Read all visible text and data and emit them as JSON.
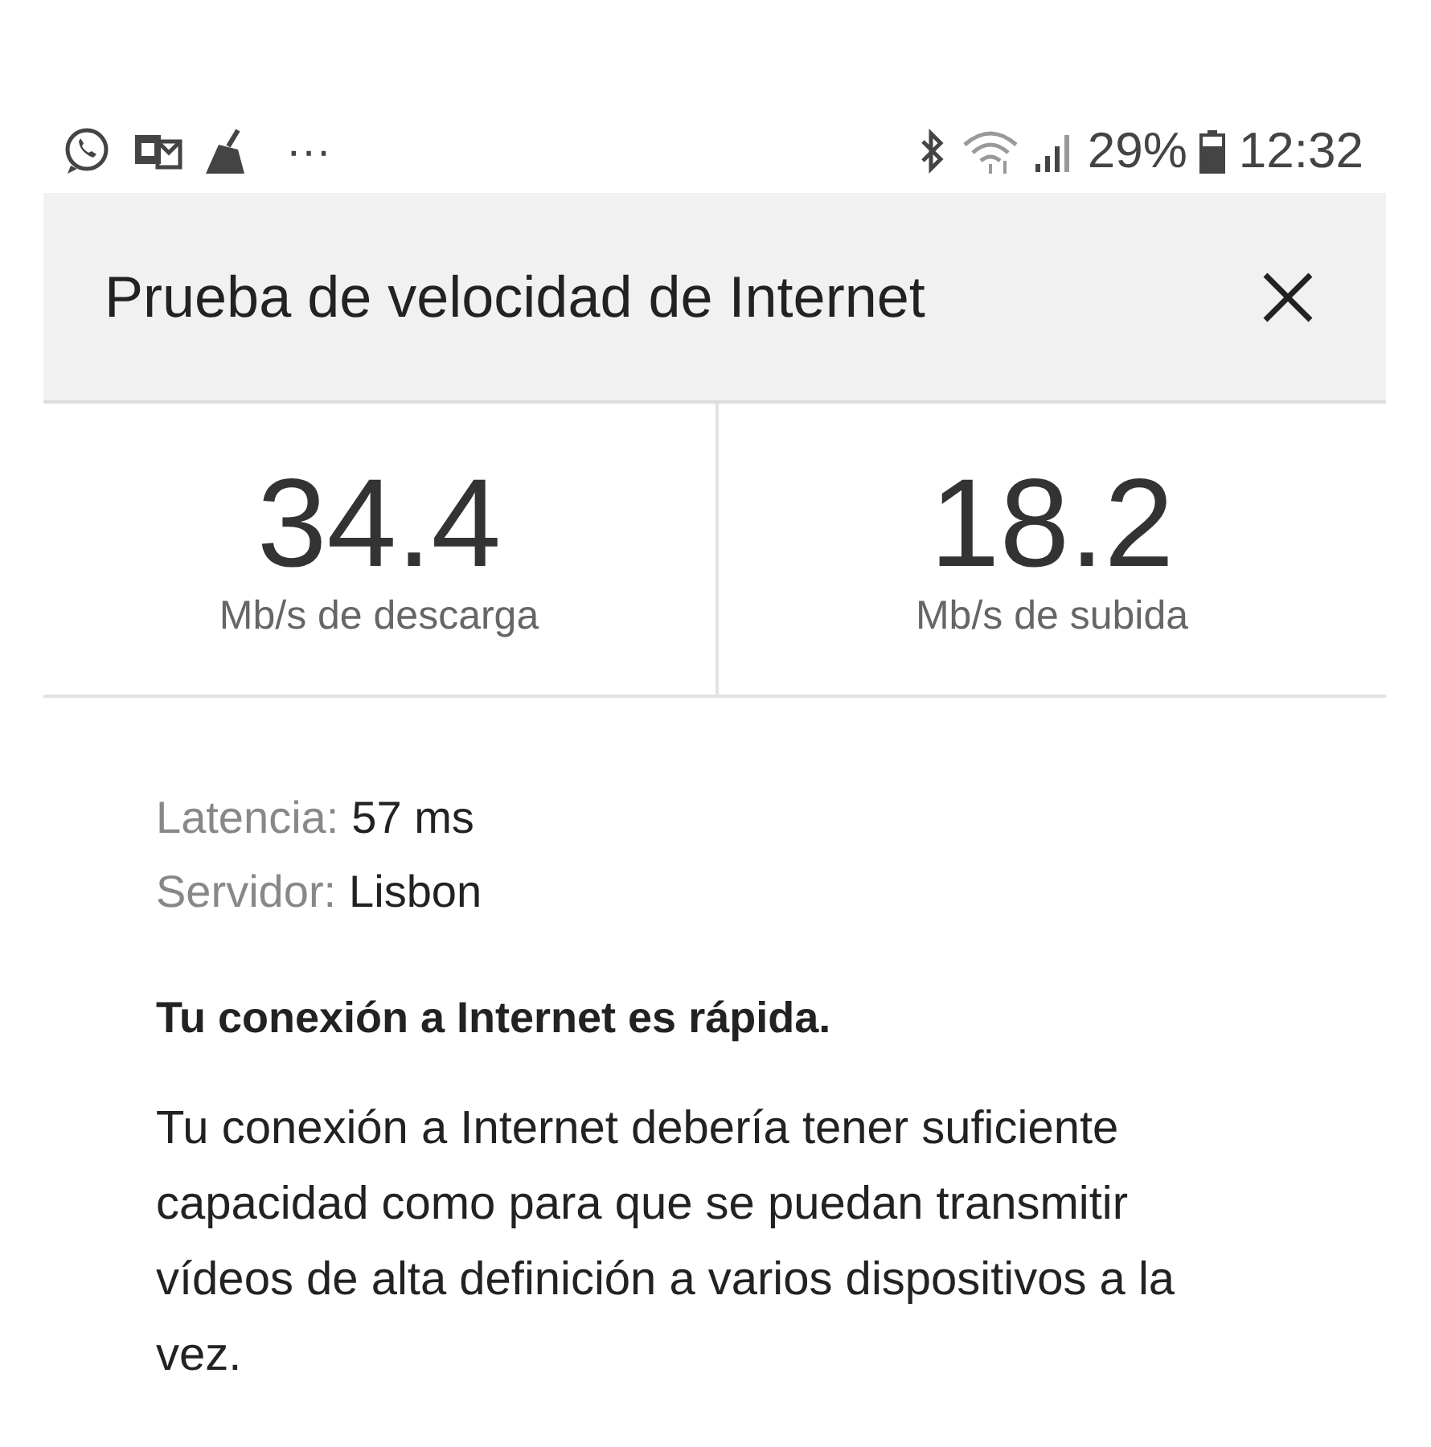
{
  "status_bar": {
    "overflow": "···",
    "battery": "29%",
    "time": "12:32"
  },
  "dialog": {
    "title": "Prueba de velocidad de Internet"
  },
  "stats": [
    {
      "value": "34.4",
      "label": "Mb/s de descarga"
    },
    {
      "value": "18.2",
      "label": "Mb/s de subida"
    }
  ],
  "details": [
    {
      "label": "Latencia:",
      "value": "57 ms"
    },
    {
      "label": "Servidor:",
      "value": "Lisbon"
    }
  ],
  "verdict": "Tu conexión a Internet es rápida.",
  "description": "Tu conexión a Internet debería tener suficiente capacidad como para que se puedan transmitir vídeos de alta definición a varios dispositivos a la vez."
}
